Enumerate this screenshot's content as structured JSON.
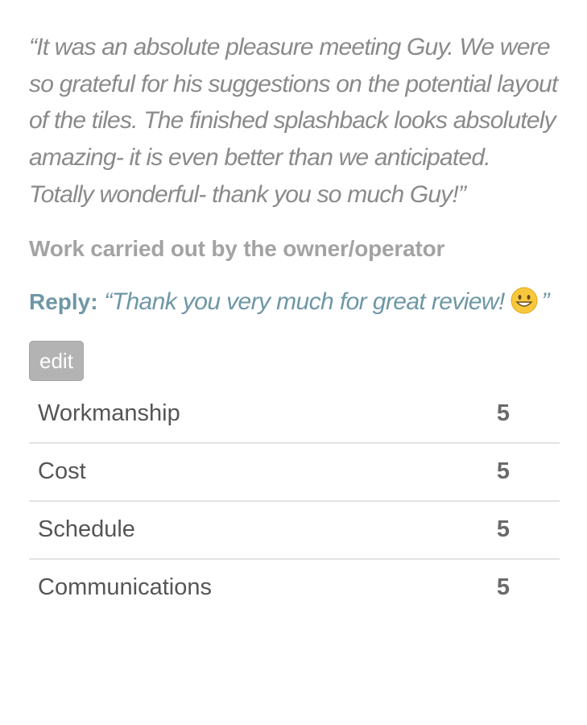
{
  "review": {
    "quote": "“It was an absolute pleasure meeting Guy. We were so grateful for his suggestions on the potential layout of the tiles. The finished splashback looks absolutely amazing- it is even better than we anticipated. Totally wonderful- thank you so much Guy!”",
    "owner_note": "Work carried out by the owner/operator",
    "reply_label": "Reply:",
    "reply_text": "“Thank you very much for great review!",
    "reply_emoji_icon": "grinning-face-icon",
    "reply_close": "”",
    "edit_label": "edit"
  },
  "ratings": [
    {
      "label": "Workmanship",
      "score": "5"
    },
    {
      "label": "Cost",
      "score": "5"
    },
    {
      "label": "Schedule",
      "score": "5"
    },
    {
      "label": "Communications",
      "score": "5"
    }
  ],
  "colors": {
    "quote_text": "#8a8a8a",
    "reply_accent": "#6e97a6",
    "edit_button_bg": "#b3b3b3",
    "divider": "#e3e3e3"
  }
}
